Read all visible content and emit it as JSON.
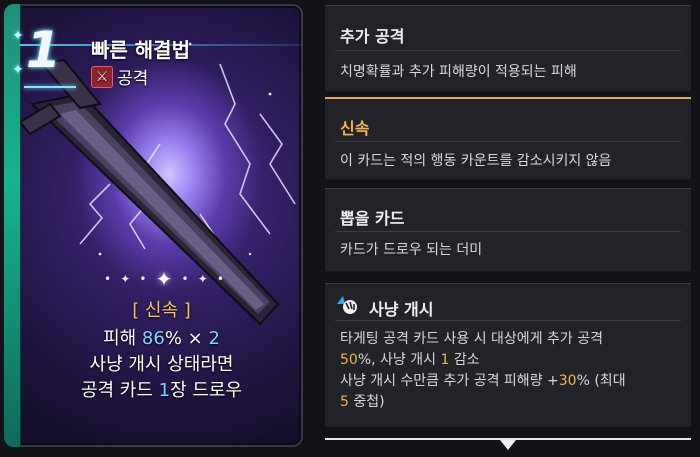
{
  "card": {
    "cost": "1",
    "title": "빠른 해결법",
    "type_label": "공격",
    "type_icon": "crossed-swords-icon",
    "effect": {
      "keyword": "[ 신속 ]",
      "line2_prefix": "피해 ",
      "line2_pct": "86",
      "line2_mid": "% × ",
      "line2_mult": "2",
      "line3": "사냥 개시 상태라면",
      "line4_prefix": "공격 카드 ",
      "line4_num": "1",
      "line4_suffix": "장 드로우"
    }
  },
  "tooltips": [
    {
      "title": "추가 공격",
      "desc": "치명확률과 추가 피해량이 적용되는 피해"
    },
    {
      "title": "신속",
      "desc": "이 카드는 적의 행동 카운트를 감소시키지 않음"
    },
    {
      "title": "뽑을 카드",
      "desc": "카드가 드로우 되는 더미"
    }
  ],
  "hunt": {
    "title": "사냥 개시",
    "icon": "hunt-claw-icon",
    "l1": "타게팅 공격 카드 사용 시 대상에게 추가 공격",
    "l2_num": "50",
    "l2_mid": "%, 사냥 개시 ",
    "l2_num2": "1",
    "l2_suffix": " 감소",
    "l3_prefix": "사냥 개시 수만큼 추가 공격 피해량 +",
    "l3_num": "30",
    "l3_suffix": "% (최대",
    "l4_num": "5",
    "l4_suffix": " 중첩)"
  },
  "colors": {
    "accent_gold": "#f2b64b",
    "accent_blue": "#7fd3ff",
    "panel_bg": "#212329",
    "rail_green": "#16b48d"
  }
}
